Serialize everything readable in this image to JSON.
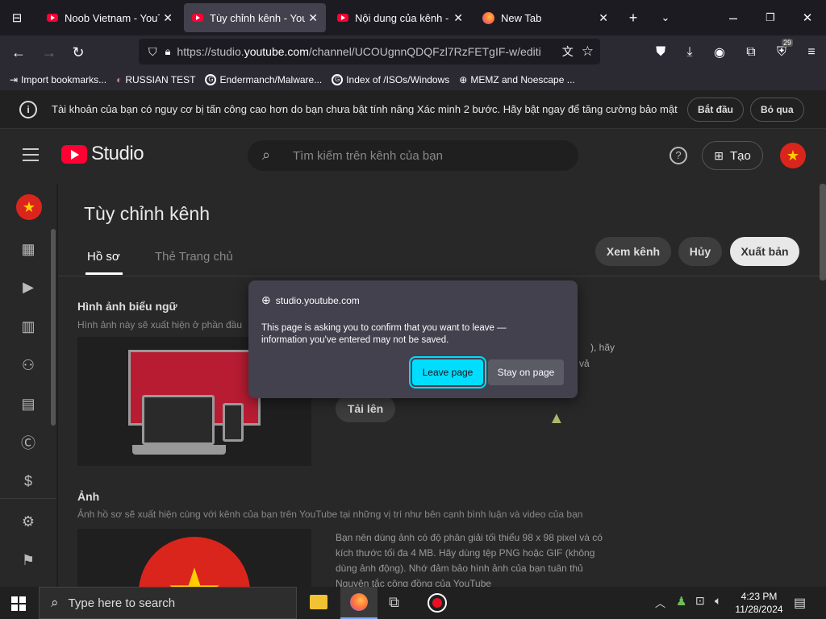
{
  "browser": {
    "tabs": [
      {
        "label": "Noob Vietnam - YouTube",
        "close": "✕"
      },
      {
        "label": "Tùy chỉnh kênh - YouTube",
        "close": "✕"
      },
      {
        "label": "Nội dung của kênh - YouTube",
        "close": "✕"
      },
      {
        "label": "New Tab",
        "close": "✕"
      }
    ],
    "url_prefix": "https://studio.",
    "url_domain": "youtube.com",
    "url_path": "/channel/UCOUgnnQDQFzl7RzFETgIF-w/editi",
    "extension_badge": "29",
    "bookmarks": [
      {
        "label": "Import bookmarks..."
      },
      {
        "label": "RUSSIAN TEST"
      },
      {
        "label": "Endermanch/Malware..."
      },
      {
        "label": "Index of /ISOs/Windows"
      },
      {
        "label": "MEMZ and Noescape ..."
      }
    ]
  },
  "banner": {
    "message": "Tài khoản của bạn có nguy cơ bị tấn công cao hơn do bạn chưa bật tính năng Xác minh 2 bước. Hãy bật ngay để tăng cường bảo mật",
    "start_label": "Bắt đầu",
    "skip_label": "Bỏ qua"
  },
  "studio": {
    "logo_text": "Studio",
    "search_placeholder": "Tìm kiếm trên kênh của bạn",
    "create_label": "Tạo",
    "page_title": "Tùy chỉnh kênh",
    "tabs": [
      {
        "label": "Hồ sơ"
      },
      {
        "label": "Thẻ Trang chủ"
      }
    ],
    "view_channel_label": "Xem kênh",
    "cancel_label": "Hủy",
    "publish_label": "Xuất bản",
    "banner_section_title": "Hình ảnh biểu ngữ",
    "banner_section_desc": "Hình ảnh này sẽ xuất hiện ở phần đầu",
    "banner_right_1": "), hãy",
    "banner_right_2": "vả",
    "upload_label": "Tải lên",
    "photo_section_title": "Ảnh",
    "photo_section_desc": "Ảnh hồ sơ sẽ xuất hiện cùng với kênh của bạn trên YouTube tại những vị trí như bên cạnh bình luận và video của bạn",
    "photo_info": "Bạn nên dùng ảnh có độ phân giải tối thiểu 98 x 98 pixel và có kích thước tối đa 4 MB. Hãy dùng tệp PNG hoặc GIF (không dùng ảnh động). Nhớ đảm bảo hình ảnh của bạn tuân thủ Nguyên tắc cộng đồng của YouTube"
  },
  "dialog": {
    "origin": "studio.youtube.com",
    "message": "This page is asking you to confirm that you want to leave — information you've entered may not be saved.",
    "leave_label": "Leave page",
    "stay_label": "Stay on page"
  },
  "taskbar": {
    "search_placeholder": "Type here to search",
    "time": "4:23 PM",
    "date": "11/28/2024"
  },
  "colors": {
    "youtube_red": "#ff0033",
    "accent_cyan": "#00ddff",
    "vn_red": "#da251d",
    "vn_yellow": "#ffcd00"
  }
}
